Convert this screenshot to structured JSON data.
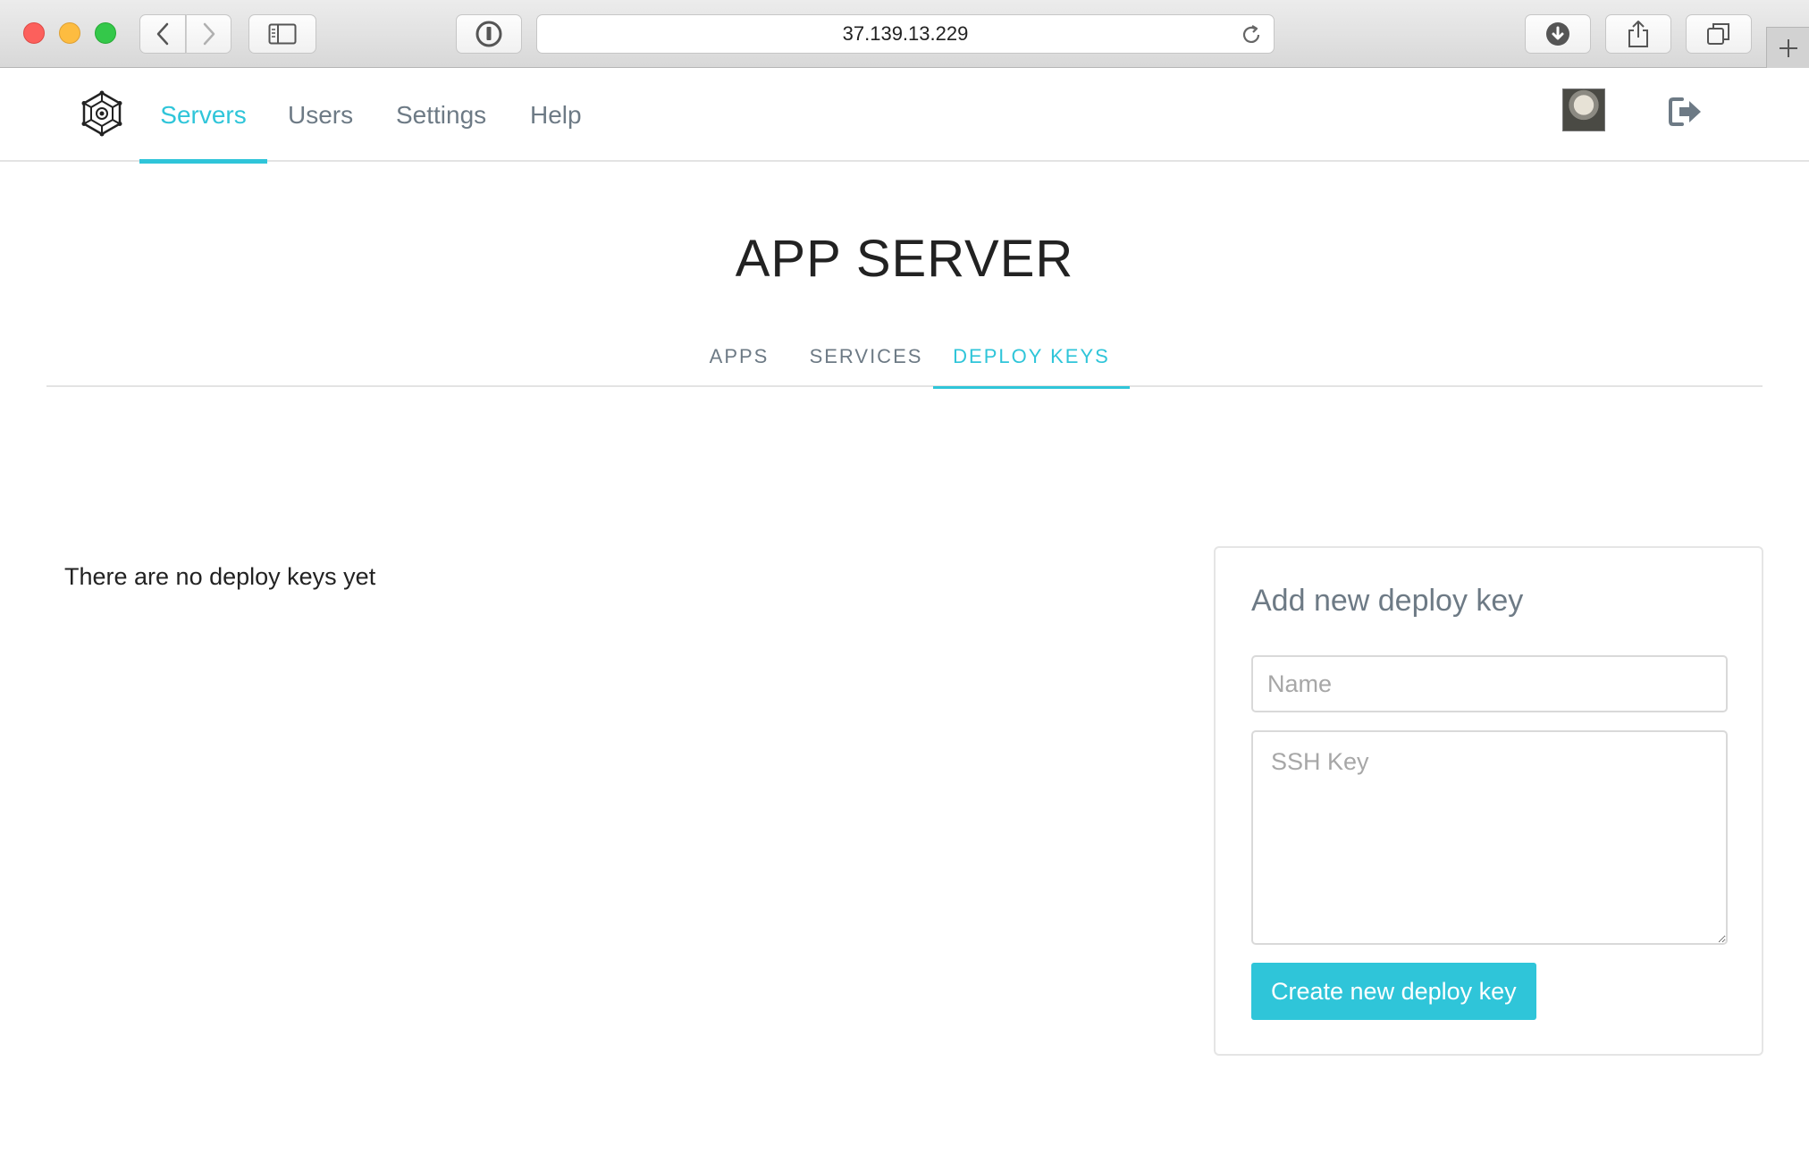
{
  "browser": {
    "url": "37.139.13.229"
  },
  "nav": {
    "items": [
      {
        "label": "Servers",
        "active": true
      },
      {
        "label": "Users",
        "active": false
      },
      {
        "label": "Settings",
        "active": false
      },
      {
        "label": "Help",
        "active": false
      }
    ]
  },
  "page": {
    "title": "APP SERVER",
    "tabs": [
      {
        "label": "APPS",
        "active": false
      },
      {
        "label": "SERVICES",
        "active": false
      },
      {
        "label": "DEPLOY KEYS",
        "active": true
      }
    ],
    "empty_message": "There are no deploy keys yet"
  },
  "deploy_form": {
    "title": "Add new deploy key",
    "name_placeholder": "Name",
    "name_value": "",
    "ssh_placeholder": "SSH Key",
    "ssh_value": "",
    "submit_label": "Create new deploy key"
  },
  "colors": {
    "accent": "#2fc5d9",
    "muted_text": "#6d7a85"
  }
}
